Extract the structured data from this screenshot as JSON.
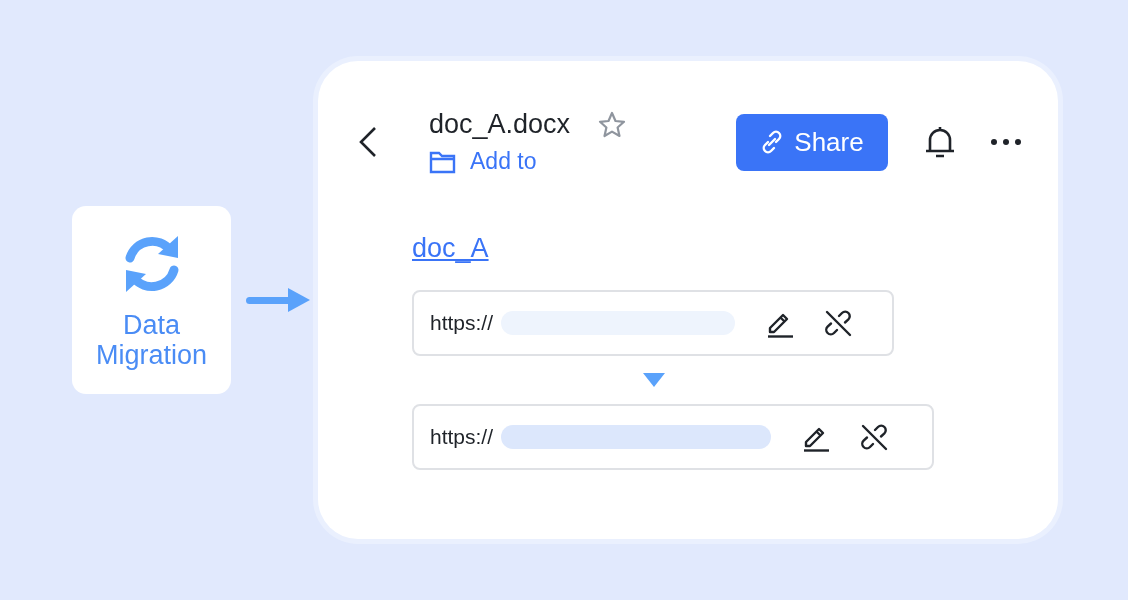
{
  "migration_badge": {
    "label": "Data Migration"
  },
  "document": {
    "title": "doc_A.docx",
    "starred": false,
    "add_to": "Add to",
    "share_button": "Share",
    "link_text": "doc_A"
  },
  "link_rows": [
    {
      "prefix": "https://",
      "kind": "original"
    },
    {
      "prefix": "https://",
      "kind": "migrated"
    }
  ]
}
